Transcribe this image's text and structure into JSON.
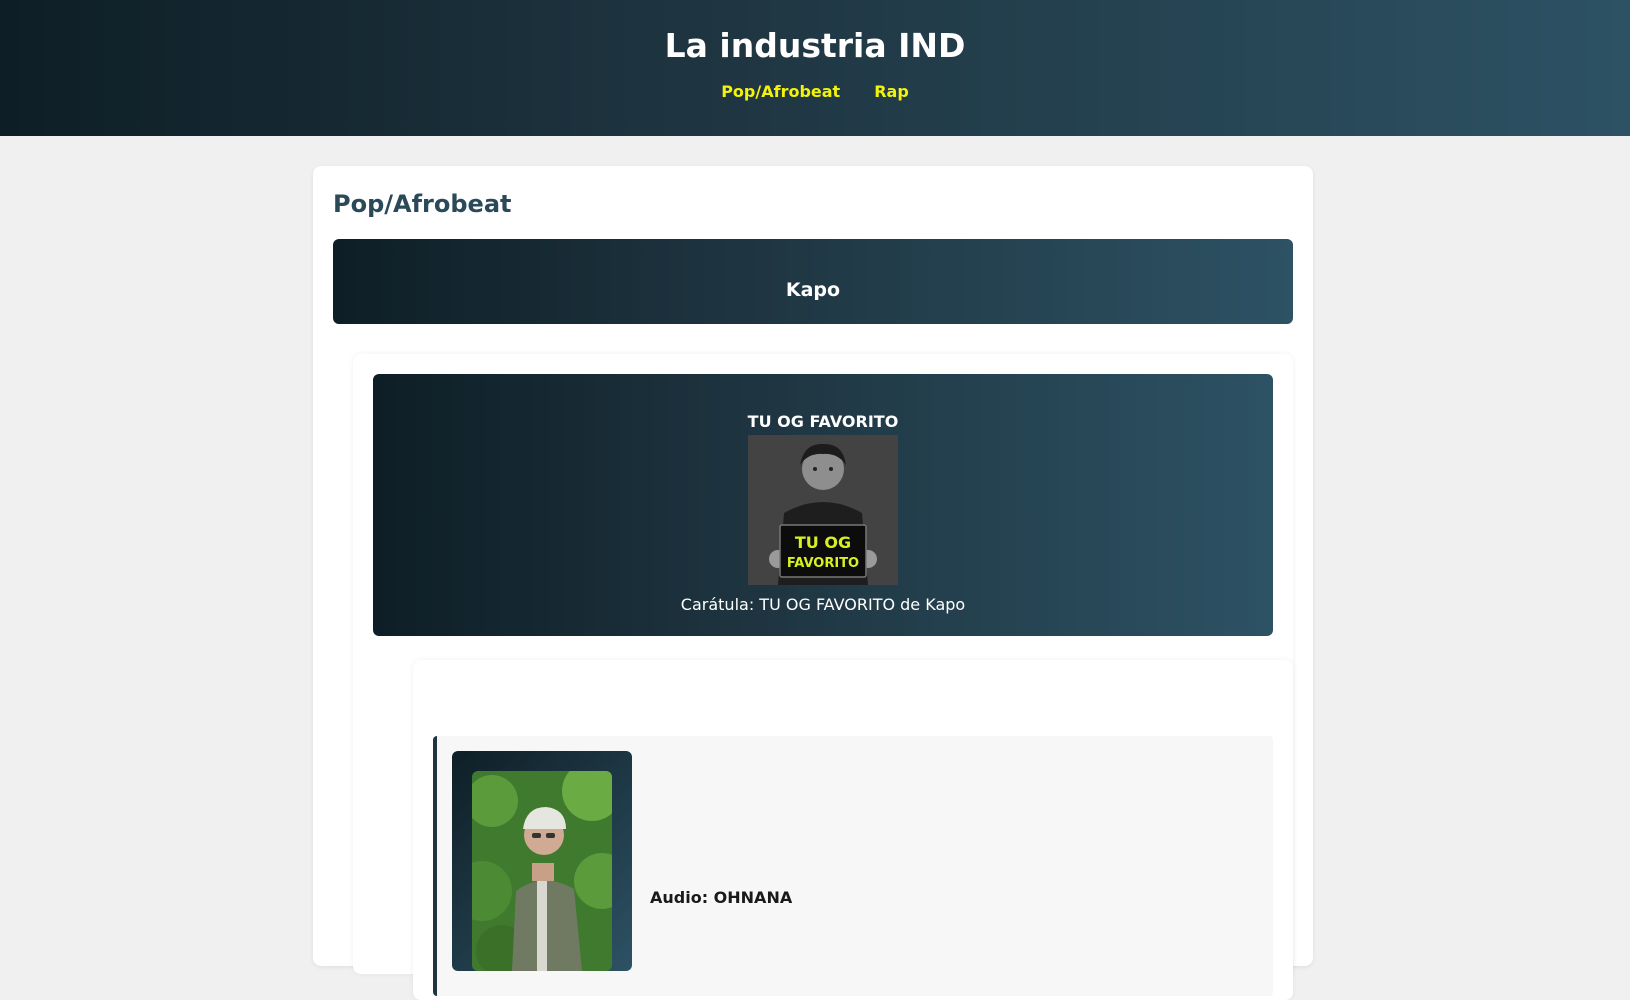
{
  "header": {
    "title": "La industria IND",
    "nav": [
      {
        "label": "Pop/Afrobeat"
      },
      {
        "label": "Rap"
      }
    ]
  },
  "section": {
    "heading": "Pop/Afrobeat"
  },
  "artist": {
    "name": "Kapo"
  },
  "album": {
    "title": "TU OG FAVORITO",
    "cover_text": "TU OG FAVORITO",
    "caption": "Carátula: TU OG FAVORITO de Kapo"
  },
  "track": {
    "audio_label": "Audio: OHNANA"
  },
  "colors": {
    "header_gradient_start": "#0e1e26",
    "header_gradient_end": "#2d5264",
    "nav_link": "#f2f20a",
    "section_heading": "#2a4a5a",
    "page_bg": "#f0f0f0"
  }
}
